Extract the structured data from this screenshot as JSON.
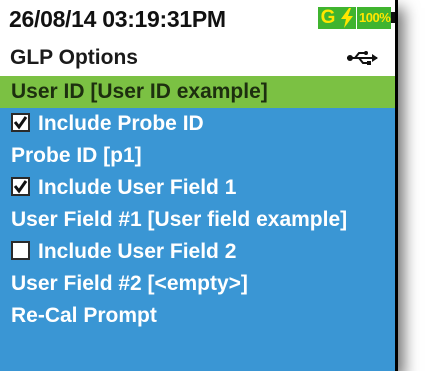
{
  "status_bar": {
    "datetime": "26/08/14  03:19:31PM",
    "mode_badge": "G",
    "charging_icon": "lightning-bolt",
    "battery_label": "100%",
    "battery_level": 1.0
  },
  "header": {
    "title": "GLP Options",
    "connection_icon": "usb-icon"
  },
  "menu": {
    "items": [
      {
        "label": "User ID [User ID example]",
        "selected": true
      },
      {
        "label": "Include Probe ID",
        "checkbox": true,
        "checked": true
      },
      {
        "label": "Probe ID [p1]"
      },
      {
        "label": "Include User Field 1",
        "checkbox": true,
        "checked": true
      },
      {
        "label": "User Field #1 [User field example]"
      },
      {
        "label": "Include User Field 2",
        "checkbox": true,
        "checked": false
      },
      {
        "label": "User Field #2 [<empty>]"
      },
      {
        "label": "Re-Cal Prompt"
      }
    ]
  },
  "colors": {
    "menu_background": "#3a96d4",
    "selected_row": "#7bc143",
    "status_green": "#3fb42f",
    "status_yellow": "#ffe600"
  }
}
